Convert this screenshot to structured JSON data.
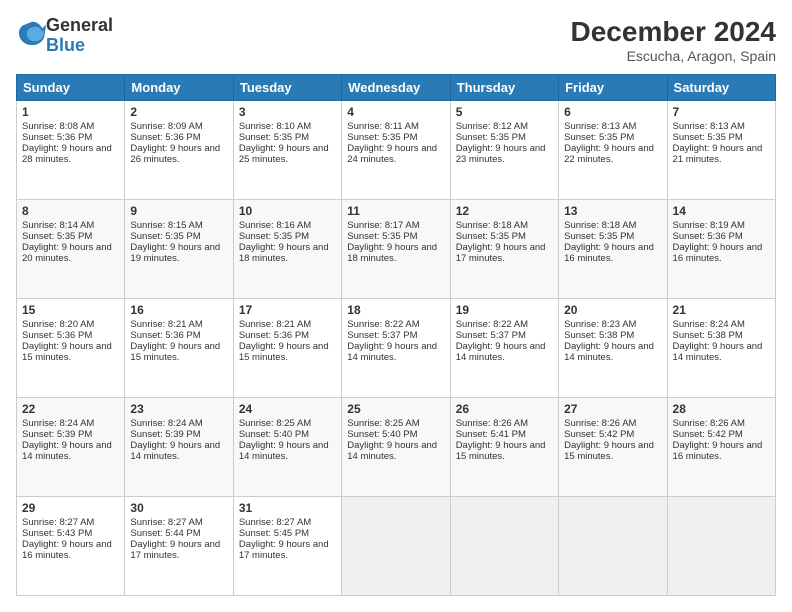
{
  "logo": {
    "general": "General",
    "blue": "Blue"
  },
  "header": {
    "month": "December 2024",
    "location": "Escucha, Aragon, Spain"
  },
  "weekdays": [
    "Sunday",
    "Monday",
    "Tuesday",
    "Wednesday",
    "Thursday",
    "Friday",
    "Saturday"
  ],
  "weeks": [
    [
      {
        "day": "1",
        "sunrise": "8:08 AM",
        "sunset": "5:36 PM",
        "daylight": "9 hours and 28 minutes."
      },
      {
        "day": "2",
        "sunrise": "8:09 AM",
        "sunset": "5:36 PM",
        "daylight": "9 hours and 26 minutes."
      },
      {
        "day": "3",
        "sunrise": "8:10 AM",
        "sunset": "5:35 PM",
        "daylight": "9 hours and 25 minutes."
      },
      {
        "day": "4",
        "sunrise": "8:11 AM",
        "sunset": "5:35 PM",
        "daylight": "9 hours and 24 minutes."
      },
      {
        "day": "5",
        "sunrise": "8:12 AM",
        "sunset": "5:35 PM",
        "daylight": "9 hours and 23 minutes."
      },
      {
        "day": "6",
        "sunrise": "8:13 AM",
        "sunset": "5:35 PM",
        "daylight": "9 hours and 22 minutes."
      },
      {
        "day": "7",
        "sunrise": "8:13 AM",
        "sunset": "5:35 PM",
        "daylight": "9 hours and 21 minutes."
      }
    ],
    [
      {
        "day": "8",
        "sunrise": "8:14 AM",
        "sunset": "5:35 PM",
        "daylight": "9 hours and 20 minutes."
      },
      {
        "day": "9",
        "sunrise": "8:15 AM",
        "sunset": "5:35 PM",
        "daylight": "9 hours and 19 minutes."
      },
      {
        "day": "10",
        "sunrise": "8:16 AM",
        "sunset": "5:35 PM",
        "daylight": "9 hours and 18 minutes."
      },
      {
        "day": "11",
        "sunrise": "8:17 AM",
        "sunset": "5:35 PM",
        "daylight": "9 hours and 18 minutes."
      },
      {
        "day": "12",
        "sunrise": "8:18 AM",
        "sunset": "5:35 PM",
        "daylight": "9 hours and 17 minutes."
      },
      {
        "day": "13",
        "sunrise": "8:18 AM",
        "sunset": "5:35 PM",
        "daylight": "9 hours and 16 minutes."
      },
      {
        "day": "14",
        "sunrise": "8:19 AM",
        "sunset": "5:36 PM",
        "daylight": "9 hours and 16 minutes."
      }
    ],
    [
      {
        "day": "15",
        "sunrise": "8:20 AM",
        "sunset": "5:36 PM",
        "daylight": "9 hours and 15 minutes."
      },
      {
        "day": "16",
        "sunrise": "8:21 AM",
        "sunset": "5:36 PM",
        "daylight": "9 hours and 15 minutes."
      },
      {
        "day": "17",
        "sunrise": "8:21 AM",
        "sunset": "5:36 PM",
        "daylight": "9 hours and 15 minutes."
      },
      {
        "day": "18",
        "sunrise": "8:22 AM",
        "sunset": "5:37 PM",
        "daylight": "9 hours and 14 minutes."
      },
      {
        "day": "19",
        "sunrise": "8:22 AM",
        "sunset": "5:37 PM",
        "daylight": "9 hours and 14 minutes."
      },
      {
        "day": "20",
        "sunrise": "8:23 AM",
        "sunset": "5:38 PM",
        "daylight": "9 hours and 14 minutes."
      },
      {
        "day": "21",
        "sunrise": "8:24 AM",
        "sunset": "5:38 PM",
        "daylight": "9 hours and 14 minutes."
      }
    ],
    [
      {
        "day": "22",
        "sunrise": "8:24 AM",
        "sunset": "5:39 PM",
        "daylight": "9 hours and 14 minutes."
      },
      {
        "day": "23",
        "sunrise": "8:24 AM",
        "sunset": "5:39 PM",
        "daylight": "9 hours and 14 minutes."
      },
      {
        "day": "24",
        "sunrise": "8:25 AM",
        "sunset": "5:40 PM",
        "daylight": "9 hours and 14 minutes."
      },
      {
        "day": "25",
        "sunrise": "8:25 AM",
        "sunset": "5:40 PM",
        "daylight": "9 hours and 14 minutes."
      },
      {
        "day": "26",
        "sunrise": "8:26 AM",
        "sunset": "5:41 PM",
        "daylight": "9 hours and 15 minutes."
      },
      {
        "day": "27",
        "sunrise": "8:26 AM",
        "sunset": "5:42 PM",
        "daylight": "9 hours and 15 minutes."
      },
      {
        "day": "28",
        "sunrise": "8:26 AM",
        "sunset": "5:42 PM",
        "daylight": "9 hours and 16 minutes."
      }
    ],
    [
      {
        "day": "29",
        "sunrise": "8:27 AM",
        "sunset": "5:43 PM",
        "daylight": "9 hours and 16 minutes."
      },
      {
        "day": "30",
        "sunrise": "8:27 AM",
        "sunset": "5:44 PM",
        "daylight": "9 hours and 17 minutes."
      },
      {
        "day": "31",
        "sunrise": "8:27 AM",
        "sunset": "5:45 PM",
        "daylight": "9 hours and 17 minutes."
      },
      null,
      null,
      null,
      null
    ]
  ],
  "labels": {
    "sunrise": "Sunrise:",
    "sunset": "Sunset:",
    "daylight": "Daylight:"
  }
}
